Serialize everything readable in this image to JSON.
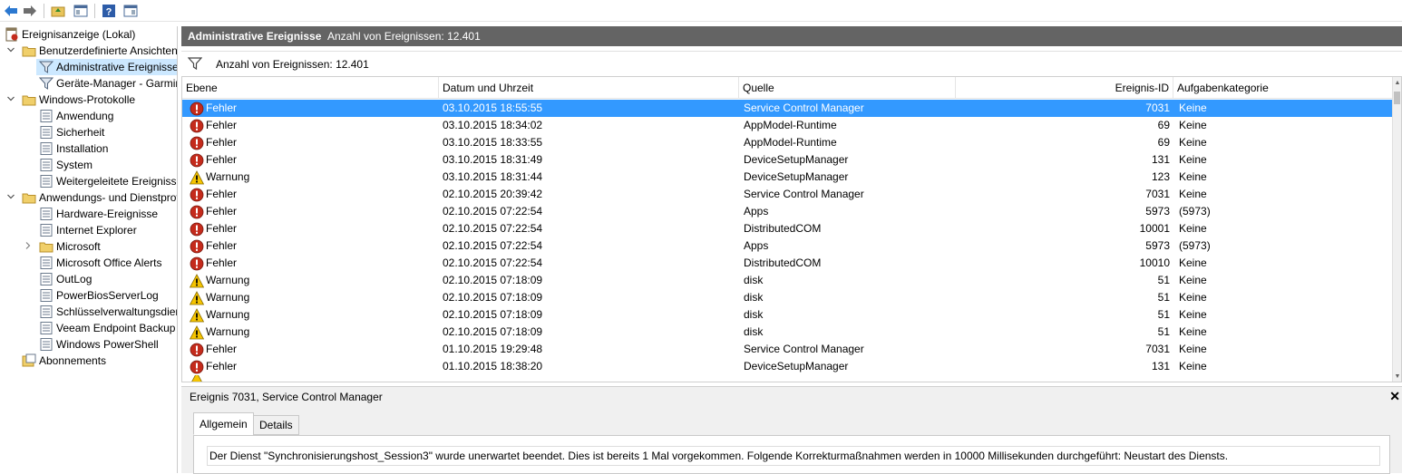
{
  "toolbar": {
    "icons": [
      "back-arrow-icon",
      "forward-arrow-icon",
      "folder-up-icon",
      "show-hide-console-tree-icon",
      "help-icon",
      "show-hide-action-pane-icon"
    ]
  },
  "tree": {
    "items": [
      {
        "label": "Ereignisanzeige (Lokal)",
        "indent": 0,
        "icon": "event-viewer-icon",
        "exp": ""
      },
      {
        "label": "Benutzerdefinierte Ansichten",
        "indent": 1,
        "icon": "folder-icon",
        "exp": "v"
      },
      {
        "label": "Administrative Ereignisse",
        "indent": 2,
        "icon": "filter-icon",
        "exp": "",
        "selected": true
      },
      {
        "label": "Geräte-Manager - Garmin",
        "indent": 2,
        "icon": "filter-icon",
        "exp": ""
      },
      {
        "label": "Windows-Protokolle",
        "indent": 1,
        "icon": "folder-icon",
        "exp": "v"
      },
      {
        "label": "Anwendung",
        "indent": 2,
        "icon": "log-icon",
        "exp": ""
      },
      {
        "label": "Sicherheit",
        "indent": 2,
        "icon": "log-icon",
        "exp": ""
      },
      {
        "label": "Installation",
        "indent": 2,
        "icon": "log-icon",
        "exp": ""
      },
      {
        "label": "System",
        "indent": 2,
        "icon": "log-icon",
        "exp": ""
      },
      {
        "label": "Weitergeleitete Ereignisse",
        "indent": 2,
        "icon": "log-icon",
        "exp": ""
      },
      {
        "label": "Anwendungs- und Dienstprotokolle",
        "indent": 1,
        "icon": "folder-icon",
        "exp": "v"
      },
      {
        "label": "Hardware-Ereignisse",
        "indent": 2,
        "icon": "log-icon",
        "exp": ""
      },
      {
        "label": "Internet Explorer",
        "indent": 2,
        "icon": "log-icon",
        "exp": ""
      },
      {
        "label": "Microsoft",
        "indent": 2,
        "icon": "folder-icon",
        "exp": ">"
      },
      {
        "label": "Microsoft Office Alerts",
        "indent": 2,
        "icon": "log-icon",
        "exp": ""
      },
      {
        "label": "OutLog",
        "indent": 2,
        "icon": "log-icon",
        "exp": ""
      },
      {
        "label": "PowerBiosServerLog",
        "indent": 2,
        "icon": "log-icon",
        "exp": ""
      },
      {
        "label": "Schlüsselverwaltungsdienst",
        "indent": 2,
        "icon": "log-icon",
        "exp": ""
      },
      {
        "label": "Veeam Endpoint Backup",
        "indent": 2,
        "icon": "log-icon",
        "exp": ""
      },
      {
        "label": "Windows PowerShell",
        "indent": 2,
        "icon": "log-icon",
        "exp": ""
      },
      {
        "label": "Abonnements",
        "indent": 1,
        "icon": "subscription-icon",
        "exp": ""
      }
    ]
  },
  "header": {
    "title": "Administrative Ereignisse",
    "count": "Anzahl von Ereignissen: 12.401"
  },
  "filterbar": {
    "text": "Anzahl von Ereignissen: 12.401"
  },
  "grid": {
    "columns": [
      "Ebene",
      "Datum und Uhrzeit",
      "Quelle",
      "Ereignis-ID",
      "Aufgabenkategorie"
    ],
    "rows": [
      {
        "level": "Fehler",
        "type": "error",
        "date": "03.10.2015 18:55:55",
        "source": "Service Control Manager",
        "id": "7031",
        "cat": "Keine",
        "selected": true
      },
      {
        "level": "Fehler",
        "type": "error",
        "date": "03.10.2015 18:34:02",
        "source": "AppModel-Runtime",
        "id": "69",
        "cat": "Keine"
      },
      {
        "level": "Fehler",
        "type": "error",
        "date": "03.10.2015 18:33:55",
        "source": "AppModel-Runtime",
        "id": "69",
        "cat": "Keine"
      },
      {
        "level": "Fehler",
        "type": "error",
        "date": "03.10.2015 18:31:49",
        "source": "DeviceSetupManager",
        "id": "131",
        "cat": "Keine"
      },
      {
        "level": "Warnung",
        "type": "warning",
        "date": "03.10.2015 18:31:44",
        "source": "DeviceSetupManager",
        "id": "123",
        "cat": "Keine"
      },
      {
        "level": "Fehler",
        "type": "error",
        "date": "02.10.2015 20:39:42",
        "source": "Service Control Manager",
        "id": "7031",
        "cat": "Keine"
      },
      {
        "level": "Fehler",
        "type": "error",
        "date": "02.10.2015 07:22:54",
        "source": "Apps",
        "id": "5973",
        "cat": "(5973)"
      },
      {
        "level": "Fehler",
        "type": "error",
        "date": "02.10.2015 07:22:54",
        "source": "DistributedCOM",
        "id": "10001",
        "cat": "Keine"
      },
      {
        "level": "Fehler",
        "type": "error",
        "date": "02.10.2015 07:22:54",
        "source": "Apps",
        "id": "5973",
        "cat": "(5973)"
      },
      {
        "level": "Fehler",
        "type": "error",
        "date": "02.10.2015 07:22:54",
        "source": "DistributedCOM",
        "id": "10010",
        "cat": "Keine"
      },
      {
        "level": "Warnung",
        "type": "warning",
        "date": "02.10.2015 07:18:09",
        "source": "disk",
        "id": "51",
        "cat": "Keine"
      },
      {
        "level": "Warnung",
        "type": "warning",
        "date": "02.10.2015 07:18:09",
        "source": "disk",
        "id": "51",
        "cat": "Keine"
      },
      {
        "level": "Warnung",
        "type": "warning",
        "date": "02.10.2015 07:18:09",
        "source": "disk",
        "id": "51",
        "cat": "Keine"
      },
      {
        "level": "Warnung",
        "type": "warning",
        "date": "02.10.2015 07:18:09",
        "source": "disk",
        "id": "51",
        "cat": "Keine"
      },
      {
        "level": "Fehler",
        "type": "error",
        "date": "01.10.2015 19:29:48",
        "source": "Service Control Manager",
        "id": "7031",
        "cat": "Keine"
      },
      {
        "level": "Fehler",
        "type": "error",
        "date": "01.10.2015 18:38:20",
        "source": "DeviceSetupManager",
        "id": "131",
        "cat": "Keine"
      }
    ]
  },
  "detail": {
    "title": "Ereignis 7031, Service Control Manager",
    "close": "✕",
    "tabs": [
      "Allgemein",
      "Details"
    ],
    "message": "Der Dienst \"Synchronisierungshost_Session3\" wurde unerwartet beendet. Dies ist bereits 1 Mal vorgekommen. Folgende Korrekturmaßnahmen werden in 10000 Millisekunden durchgeführt: Neustart des Diensts."
  },
  "colors": {
    "header_bg": "#646464",
    "selection": "#3399ff",
    "tree_selection": "#cce8ff",
    "error": "#c42b1c",
    "warning": "#f5c400"
  }
}
